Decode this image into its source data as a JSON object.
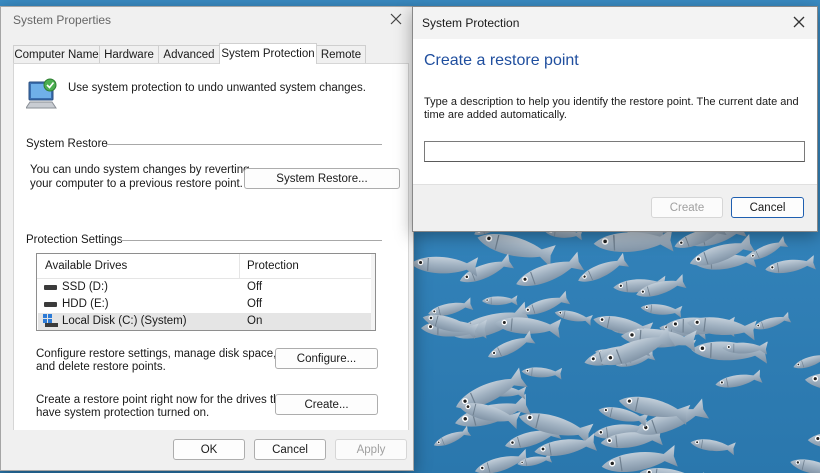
{
  "system_properties": {
    "title": "System Properties",
    "tabs": [
      "Computer Name",
      "Hardware",
      "Advanced",
      "System Protection",
      "Remote"
    ],
    "active_tab": "System Protection",
    "intro_text": "Use system protection to undo unwanted system changes.",
    "system_restore": {
      "heading": "System Restore",
      "description_line1": "You can undo system changes by reverting",
      "description_line2": "your computer to a previous restore point.",
      "button_label": "System Restore..."
    },
    "protection_settings": {
      "heading": "Protection Settings",
      "columns": [
        "Available Drives",
        "Protection"
      ],
      "drives": [
        {
          "name": "SSD (D:)",
          "protection": "Off",
          "icon": "drive-icon",
          "selected": false
        },
        {
          "name": "HDD (E:)",
          "protection": "Off",
          "icon": "drive-icon",
          "selected": false
        },
        {
          "name": "Local Disk (C:) (System)",
          "protection": "On",
          "icon": "windows-drive-icon",
          "selected": true
        }
      ],
      "configure_text_line1": "Configure restore settings, manage disk space,",
      "configure_text_line2": "and delete restore points.",
      "configure_button": "Configure...",
      "create_text_line1": "Create a restore point right now for the drives that",
      "create_text_line2": "have system protection turned on.",
      "create_button": "Create..."
    },
    "footer": {
      "ok": "OK",
      "cancel": "Cancel",
      "apply": "Apply"
    }
  },
  "system_protection_dialog": {
    "title": "System Protection",
    "heading": "Create a restore point",
    "description_line1": "Type a description to help you identify the restore point. The current date and",
    "description_line2": "time are added automatically.",
    "input_value": "",
    "create_button": "Create",
    "cancel_button": "Cancel"
  },
  "colors": {
    "accent": "#1f5fb0",
    "heading_blue": "#1f4e9e",
    "water": "#2f7fb6"
  }
}
